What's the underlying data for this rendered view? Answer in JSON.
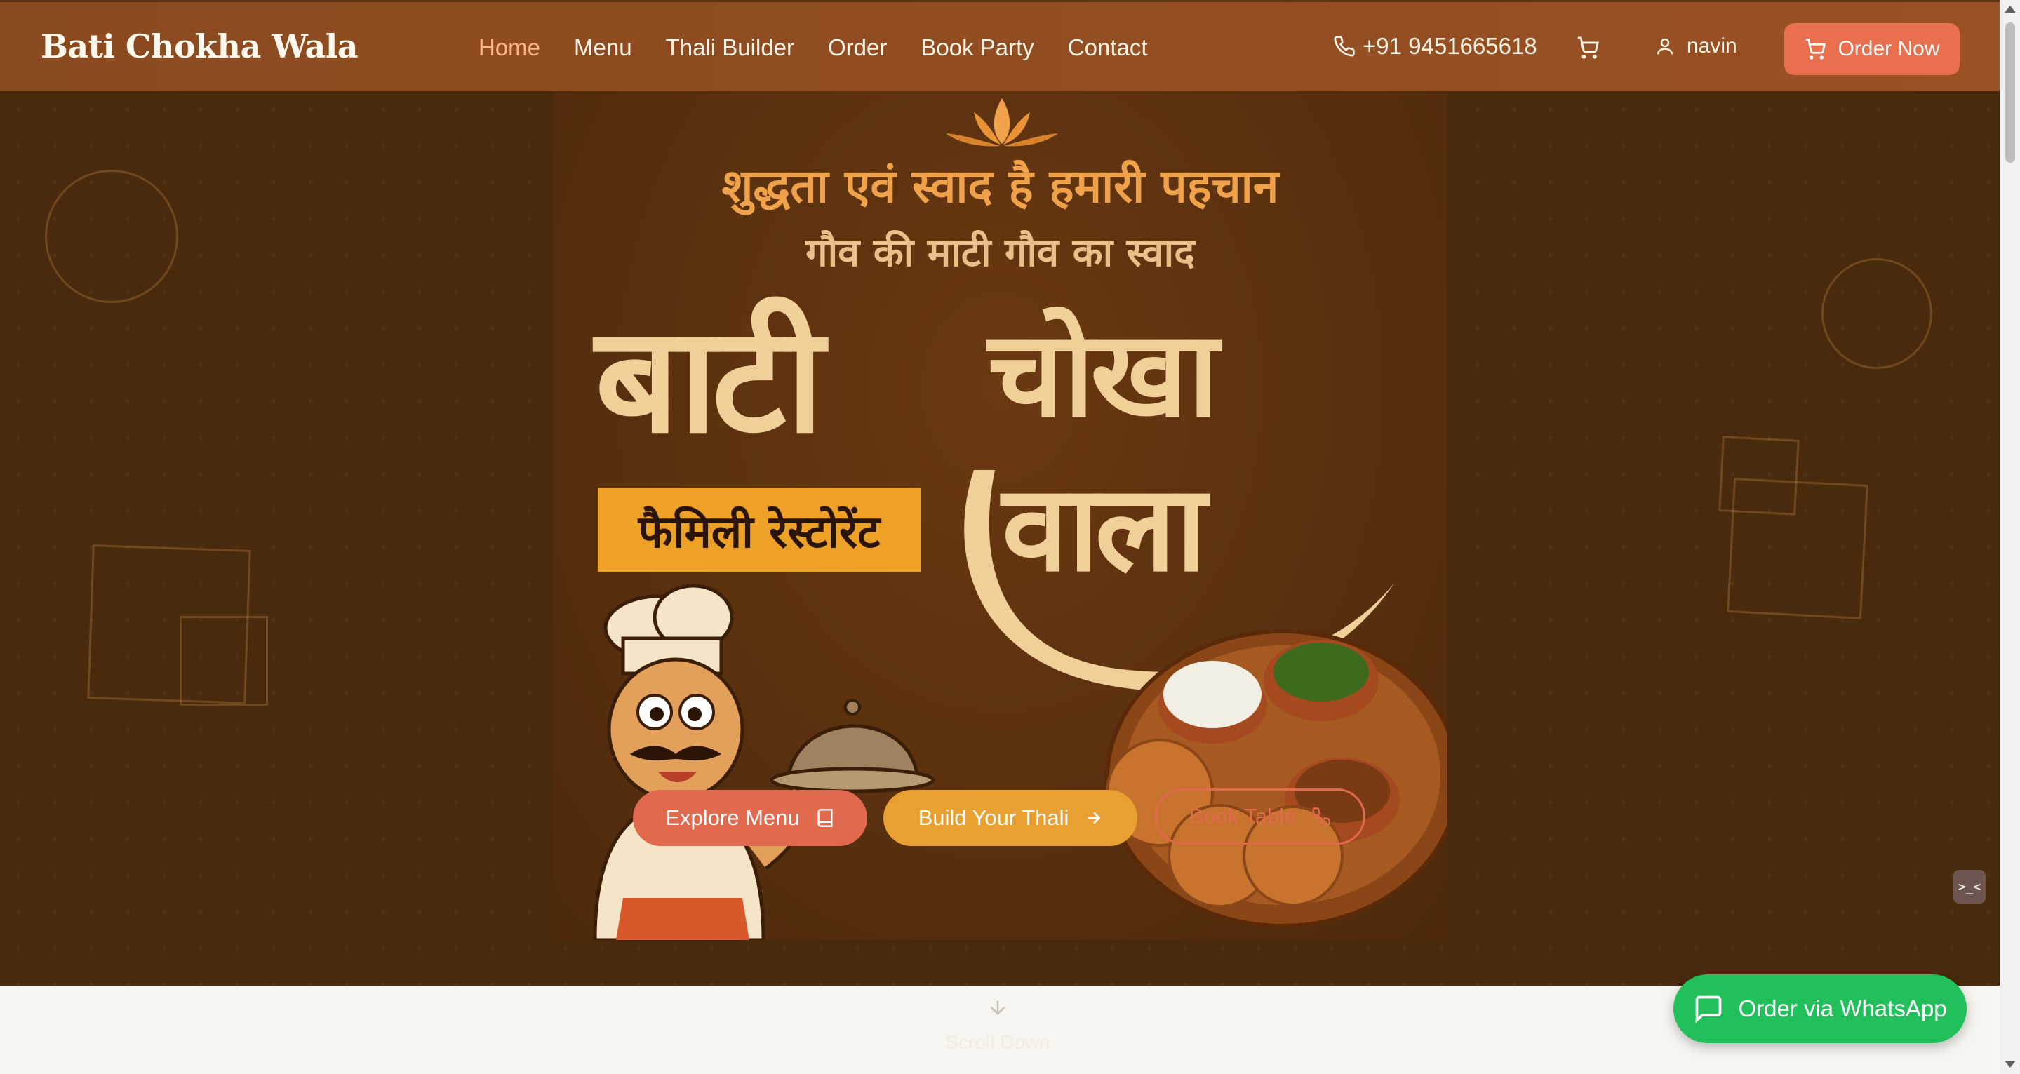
{
  "nav": {
    "brand": "Bati Chokha Wala",
    "links": [
      {
        "label": "Home",
        "active": true
      },
      {
        "label": "Menu",
        "active": false
      },
      {
        "label": "Thali Builder",
        "active": false
      },
      {
        "label": "Order",
        "active": false
      },
      {
        "label": "Book Party",
        "active": false
      },
      {
        "label": "Contact",
        "active": false
      }
    ],
    "phone": "+91 9451665618",
    "user_name": "navin",
    "order_now": "Order Now"
  },
  "hero": {
    "tagline_1": "शुद्धता एवं स्वाद है हमारी पहचान",
    "tagline_2": "गौव की माटी गौव का स्वाद",
    "title_word_1": "बाटी",
    "title_word_2": "चोखा",
    "title_word_3": "वाला",
    "badge": "फैमिली रेस्टोरेंट",
    "buttons": {
      "explore": "Explore Menu",
      "thali": "Build Your Thali",
      "book": "Book Table"
    }
  },
  "scroll_hint": "Scroll Down",
  "whatsapp": "Order via WhatsApp",
  "colors": {
    "nav_bg": "#8a4a1f",
    "accent": "#e0694e",
    "gold": "#e9a032",
    "whatsapp": "#22c05a",
    "hero_bg": "#4a2a0c"
  },
  "icons": [
    "phone-icon",
    "cart-icon",
    "user-icon",
    "book-icon",
    "arrow-right-icon",
    "arrow-down-icon",
    "chat-icon"
  ]
}
